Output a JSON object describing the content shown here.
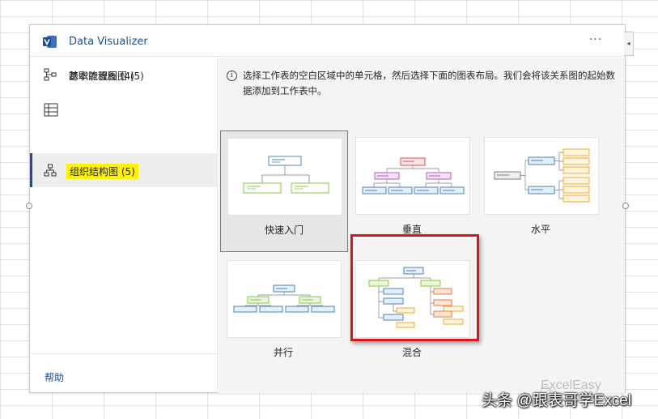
{
  "header": {
    "title": "Data Visualizer",
    "more_label": "···",
    "collapse_label": "◂"
  },
  "sidebar": {
    "items": [
      {
        "label": "基本流程图 (4)",
        "icon": "basic-flowchart-icon",
        "selected": false
      },
      {
        "label": "跨职能流程图 (5)",
        "icon": "cross-functional-flowchart-icon",
        "selected": false
      },
      {
        "label": "组织结构图 (5)",
        "icon": "org-chart-icon",
        "selected": true
      }
    ],
    "help_label": "帮助"
  },
  "content": {
    "info_icon_label": "i",
    "info_text": "选择工作表的空白区域中的单元格，然后选择下面的图表布局。我们会将该关系图的起始数据添加到工作表中。",
    "layouts": [
      {
        "label": "快速入门",
        "selected": true
      },
      {
        "label": "垂直",
        "selected": false
      },
      {
        "label": "水平",
        "selected": false
      },
      {
        "label": "并行",
        "selected": false
      },
      {
        "label": "混合",
        "selected": false,
        "highlighted": true
      }
    ]
  },
  "watermarks": {
    "small": "ExcelEasy",
    "big": "头条 @跟表哥学Excel"
  },
  "colors": {
    "accent": "#1f4e8c",
    "highlight": "#fff200",
    "annotation_red": "#d8161b"
  }
}
